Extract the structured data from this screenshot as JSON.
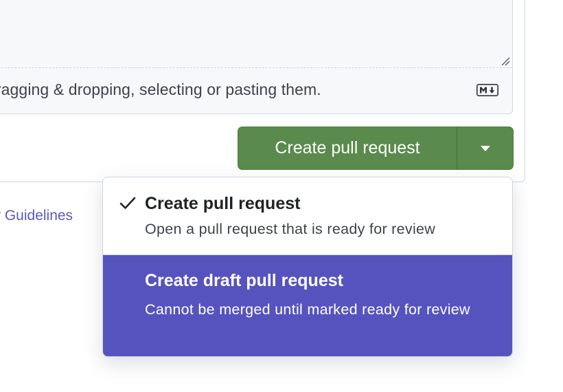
{
  "editor": {
    "attach_hint": "dragging & dropping, selecting or pasting them.",
    "markdown_icon": "markdown-icon",
    "resize_icon": "resize-grip-icon"
  },
  "actions": {
    "create_button_label": "Create pull request",
    "dropdown_icon": "triangle-down-icon",
    "accent_color": "#5a8a4c"
  },
  "footer": {
    "guidelines_link": "ity Guidelines"
  },
  "menu": {
    "highlight_color": "#5653bf",
    "items": [
      {
        "title": "Create pull request",
        "description": "Open a pull request that is ready for review",
        "selected": true,
        "icon": "check-icon"
      },
      {
        "title": "Create draft pull request",
        "description": "Cannot be merged until marked ready for review",
        "selected": false
      }
    ]
  }
}
